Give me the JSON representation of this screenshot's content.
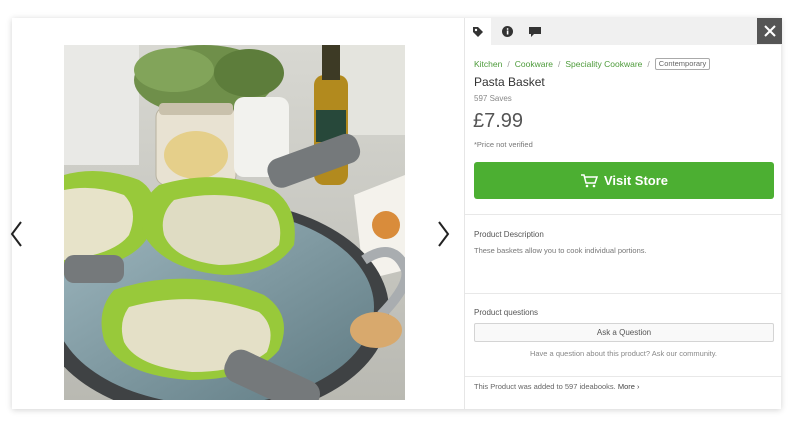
{
  "gallery": {
    "prev_icon": "chevron-left-icon",
    "next_icon": "chevron-right-icon",
    "image_icon": "product-photo"
  },
  "tabs": [
    {
      "icon": "price-tag-icon",
      "active": true
    },
    {
      "icon": "info-icon",
      "active": false
    },
    {
      "icon": "comment-icon",
      "active": false
    }
  ],
  "close_icon": "close-icon",
  "breadcrumb": {
    "items": [
      "Kitchen",
      "Cookware",
      "Speciality Cookware"
    ],
    "separator": "/",
    "tag": "Contemporary"
  },
  "product": {
    "title": "Pasta Basket",
    "saves": "597 Saves",
    "price": "£7.99",
    "price_note": "*Price not verified"
  },
  "visit_button": {
    "label": "Visit Store",
    "icon": "cart-icon",
    "color": "#4caf32"
  },
  "description": {
    "heading": "Product Description",
    "text": "These baskets allow you to cook individual portions."
  },
  "questions": {
    "heading": "Product questions",
    "button_label": "Ask a Question",
    "note": "Have a question about this product? Ask our community."
  },
  "ideabooks": {
    "text": "This Product was added to 597 ideabooks.",
    "more_label": "More ›"
  },
  "colors": {
    "accent": "#4caf32",
    "link": "#4d9b3a",
    "close_bg": "#555555"
  }
}
